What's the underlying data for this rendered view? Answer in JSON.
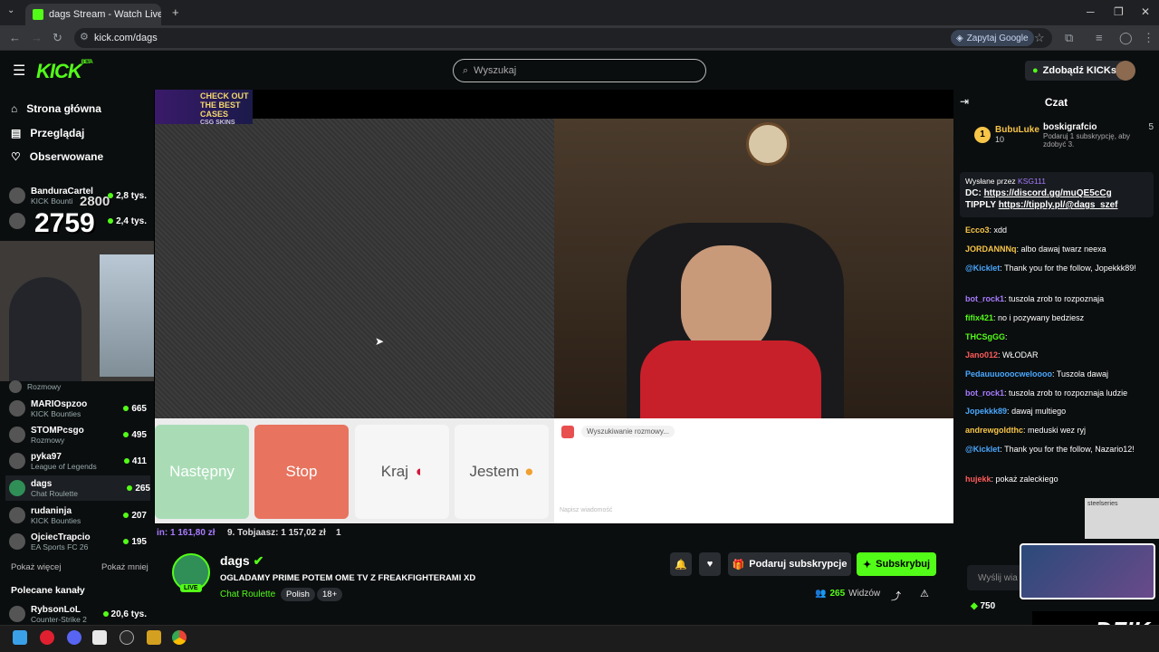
{
  "browser": {
    "tab_title": "dags Stream - Watch Live o",
    "url": "kick.com/dags",
    "google_btn": "Zapytaj Google"
  },
  "header": {
    "logo": "KICK",
    "logo_badge": "BETA",
    "search_placeholder": "Wyszukaj",
    "kicks_btn": "Zdobądź KICKs"
  },
  "sidebar": {
    "nav": [
      {
        "label": "Strona główna",
        "icon": "home-icon"
      },
      {
        "label": "Przeglądaj",
        "icon": "browse-icon"
      },
      {
        "label": "Obserwowane",
        "icon": "heart-icon"
      }
    ],
    "channels": [
      {
        "name": "BanduraCartel",
        "game": "KICK Bounti",
        "viewers": "2,8 tys."
      },
      {
        "name": "",
        "game": "",
        "viewers": "2,4 tys."
      },
      {
        "name": "",
        "game": "Rozmowy",
        "viewers": ""
      },
      {
        "name": "MARIOspzoo",
        "game": "KICK Bounties",
        "viewers": "665"
      },
      {
        "name": "STOMPcsgo",
        "game": "Rozmowy",
        "viewers": "495"
      },
      {
        "name": "pyka97",
        "game": "League of Legends",
        "viewers": "411"
      },
      {
        "name": "dags",
        "game": "Chat Roulette",
        "viewers": "265"
      },
      {
        "name": "rudaninja",
        "game": "KICK Bounties",
        "viewers": "207"
      },
      {
        "name": "OjciecTrapcio",
        "game": "EA Sports FC 26",
        "viewers": "195"
      }
    ],
    "show_more": "Pokaż więcej",
    "show_less": "Pokaż mniej",
    "recommended_title": "Polecane kanały",
    "recommended": [
      {
        "name": "RybsonLoL",
        "game": "Counter-Strike 2",
        "viewers": "20,6 tys."
      }
    ],
    "overlay_counter_small": "2800",
    "overlay_counter_big": "2759"
  },
  "player": {
    "ad_text": "CHECK OUT THE BEST CASES",
    "ad_brand": "CSG SKINS",
    "buttons": [
      "Następny",
      "Stop",
      "Kraj",
      "Jestem"
    ],
    "chat_status": "Wyszukiwanie rozmowy...",
    "chat_input_placeholder": "Napisz wiadomość",
    "ticker": [
      "in: 1 161,80 zł",
      "9. Tobjaasz: 1 157,02 zł",
      "1"
    ]
  },
  "stream": {
    "channel": "dags",
    "title": "OGLADAMY PRIME POTEM OME TV Z FREAKFIGHTERAMI XD",
    "category": "Chat Roulette",
    "tags": [
      "Polish",
      "18+"
    ],
    "live": "LIVE",
    "gift_btn": "Podaruj subskrypcje",
    "subscribe_btn": "Subskrybuj",
    "viewers_count": "265",
    "viewers_label": "Widzów"
  },
  "chat": {
    "title": "Czat",
    "top_gifter": {
      "name": "BubuLuke",
      "count": "10"
    },
    "gift_user": {
      "name": "boskigrafcio",
      "count": "5",
      "text": "Podaruj 1 subskrypcję, aby zdobyć 3."
    },
    "pinned_by": "Wysłane przez",
    "pinned_user": "KSG111",
    "pinned_line1_prefix": "DC: ",
    "pinned_line1_link": "https://discord.gg/muQE5cCg",
    "pinned_line2_prefix": "TIPPLY ",
    "pinned_line2_link": "https://tipply.pl/@dags_szef",
    "messages": [
      {
        "user": "Ecco3",
        "color": "#f7c548",
        "text": "xdd"
      },
      {
        "user": "JORDANNNq",
        "color": "#f7c548",
        "text": "albo dawaj twarz neexa"
      },
      {
        "user": "@Kicklet",
        "color": "#4aa8ff",
        "text": "Thank you for the follow, Jopekkk89!"
      },
      {
        "user": "bot_rock1",
        "color": "#a77bff",
        "text": "tuszola zrob to rozpoznaja"
      },
      {
        "user": "fifix421",
        "color": "#53fc18",
        "text": "no i pozywany bedziesz"
      },
      {
        "user": "THCSgGG",
        "color": "#53fc18",
        "text": ""
      },
      {
        "user": "Jano012",
        "color": "#ff5b5b",
        "text": "WŁODAR"
      },
      {
        "user": "Pedauuuooocweloooo",
        "color": "#4aa8ff",
        "text": "Tuszola dawaj"
      },
      {
        "user": "bot_rock1",
        "color": "#a77bff",
        "text": "tuszola zrob to rozpoznaja ludzie"
      },
      {
        "user": "Jopekkk89",
        "color": "#4aa8ff",
        "text": "dawaj multiego"
      },
      {
        "user": "andrewgoldthc",
        "color": "#f7c548",
        "text": "meduski wez ryj"
      },
      {
        "user": "@Kicklet",
        "color": "#4aa8ff",
        "text": "Thank you for the follow, Nazario12!"
      },
      {
        "user": "hujekk",
        "color": "#ff5b5b",
        "text": "pokaż zaleckiego"
      }
    ],
    "input_placeholder": "Wyślij wia",
    "points": "750",
    "steelseries": "steelseries",
    "dzik": "DZIK"
  }
}
